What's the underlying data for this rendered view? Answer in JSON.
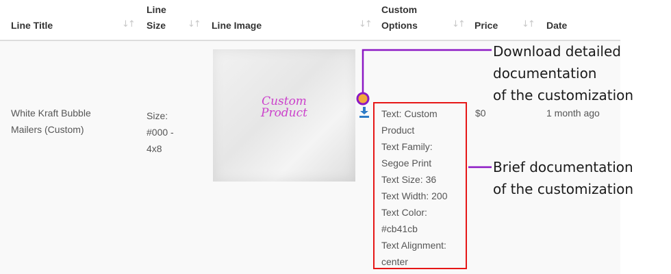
{
  "table": {
    "columns": [
      {
        "label_line1": "Line Title",
        "label_line2": ""
      },
      {
        "label_line1": "Line",
        "label_line2": "Size"
      },
      {
        "label_line1": "Line Image",
        "label_line2": ""
      },
      {
        "label_line1": "Custom",
        "label_line2": "Options"
      },
      {
        "label_line1": "Price",
        "label_line2": ""
      },
      {
        "label_line1": "Date",
        "label_line2": ""
      }
    ],
    "row": {
      "title_line1": "White Kraft Bubble",
      "title_line2": "Mailers (Custom)",
      "size_line1": "Size:",
      "size_line2": "#000 -",
      "size_line3": "4x8",
      "image_text_line1": "Custom",
      "image_text_line2": "Product",
      "options": [
        "Text: Custom",
        "Product",
        "Text Family:",
        "Segoe Print",
        "Text Size: 36",
        "Text Width: 200",
        "Text Color:",
        "#cb41cb",
        "Text Alignment:",
        "center"
      ],
      "price": "$0",
      "date": "1 month ago"
    }
  },
  "annotations": {
    "download": {
      "line1": "Download detailed",
      "line2": "documentation",
      "line3": "of the customization"
    },
    "brief": {
      "line1": "Brief documentation",
      "line2": "of the customization"
    }
  },
  "colors": {
    "annotation_line": "#8b18c4",
    "annotation_dot": "#f2a93b",
    "highlight_box": "#e61616",
    "download_icon": "#2e7bc6",
    "image_text": "#cb41cb"
  },
  "icons": {
    "sort": "sort-arrows-icon",
    "download": "download-icon"
  }
}
